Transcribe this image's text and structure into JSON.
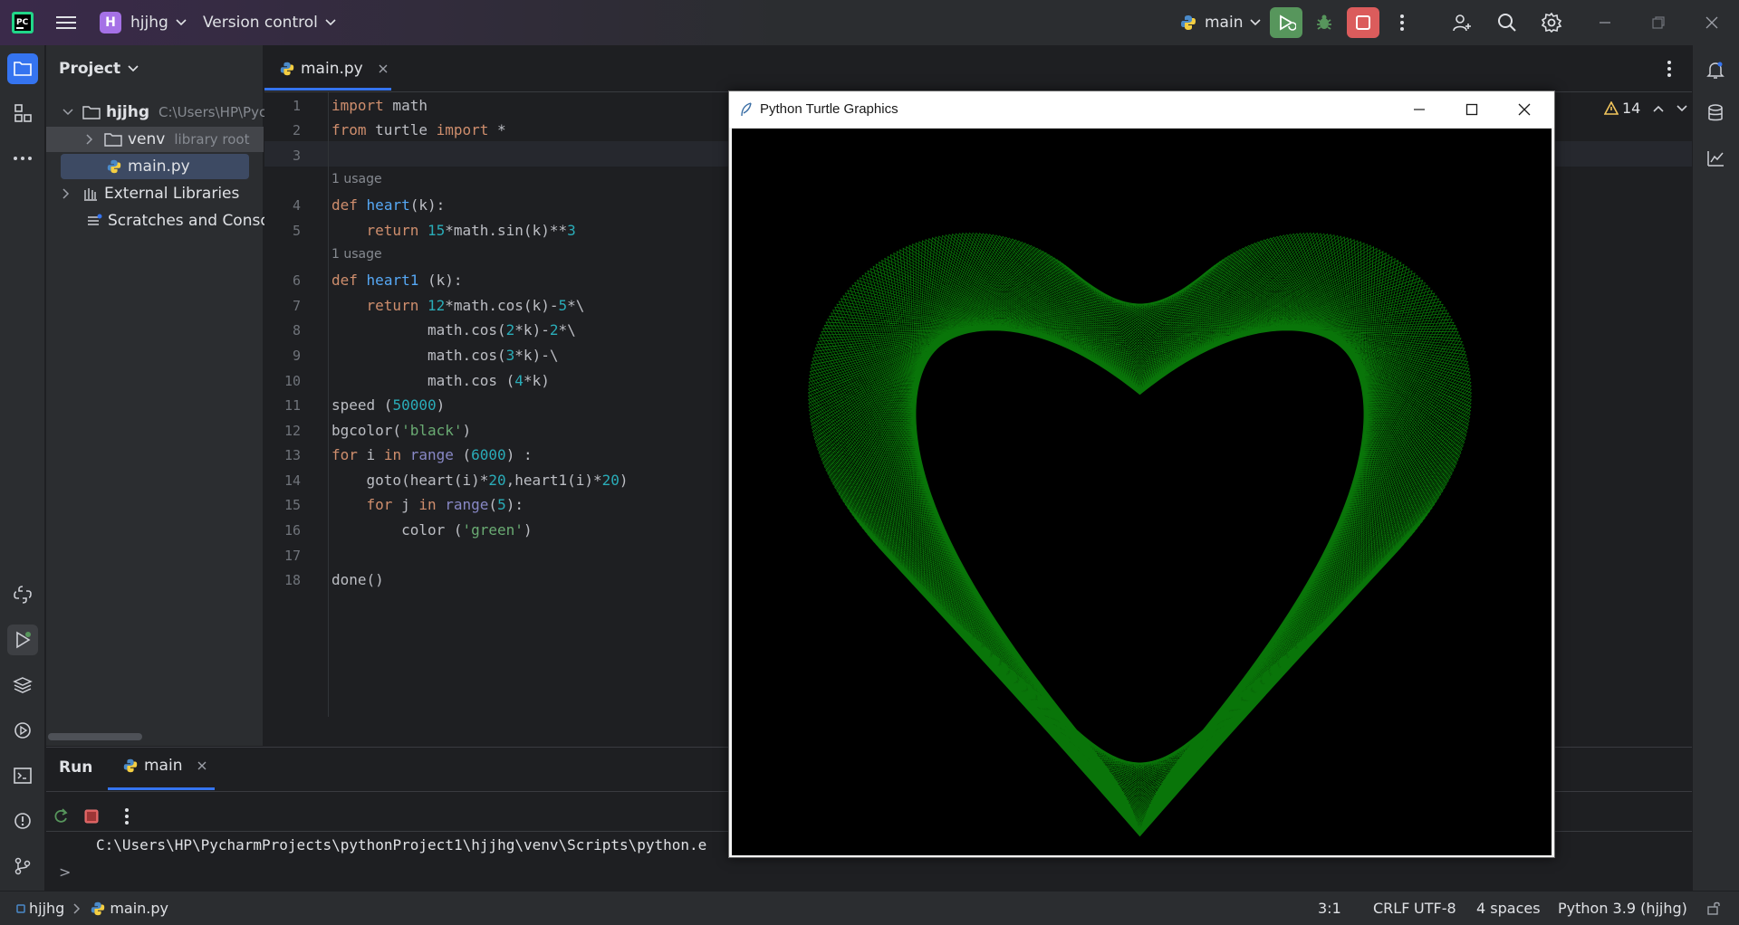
{
  "titlebar": {
    "project_initial": "H",
    "project_name": "hjjhg",
    "vcs_label": "Version control",
    "run_config": "main"
  },
  "project_panel": {
    "title": "Project",
    "tree": [
      {
        "label": "hjjhg",
        "hint": "C:\\Users\\HP\\Pyc"
      },
      {
        "label": "venv",
        "hint": "library root"
      },
      {
        "label": "main.py",
        "hint": ""
      },
      {
        "label": "External Libraries",
        "hint": ""
      },
      {
        "label": "Scratches and Console",
        "hint": ""
      }
    ]
  },
  "editor": {
    "tab_label": "main.py",
    "warnings_count": "14",
    "usage_hint": "1 usage",
    "line_numbers": [
      "1",
      "2",
      "3",
      "4",
      "5",
      "6",
      "7",
      "8",
      "9",
      "10",
      "11",
      "12",
      "13",
      "14",
      "15",
      "16",
      "17",
      "18"
    ]
  },
  "turtle_window": {
    "title": "Python Turtle Graphics",
    "background": "#000000",
    "pen_color": "#0b8a0b"
  },
  "run_panel": {
    "tab_run": "Run",
    "tab_config": "main",
    "console_line": "C:\\Users\\HP\\PycharmProjects\\pythonProject1\\hjjhg\\venv\\Scripts\\python.e",
    "prompt_glyph": ">"
  },
  "statusbar": {
    "crumb_project": "hjjhg",
    "crumb_file": "main.py",
    "position": "3:1",
    "line_sep": "CRLF",
    "encoding": "UTF-8",
    "indent": "4 spaces",
    "interpreter": "Python 3.9 (hjjhg)"
  },
  "colors": {
    "accent_run": "#57965c",
    "accent_stop": "#db5c5c",
    "badge": "#a571e6"
  }
}
